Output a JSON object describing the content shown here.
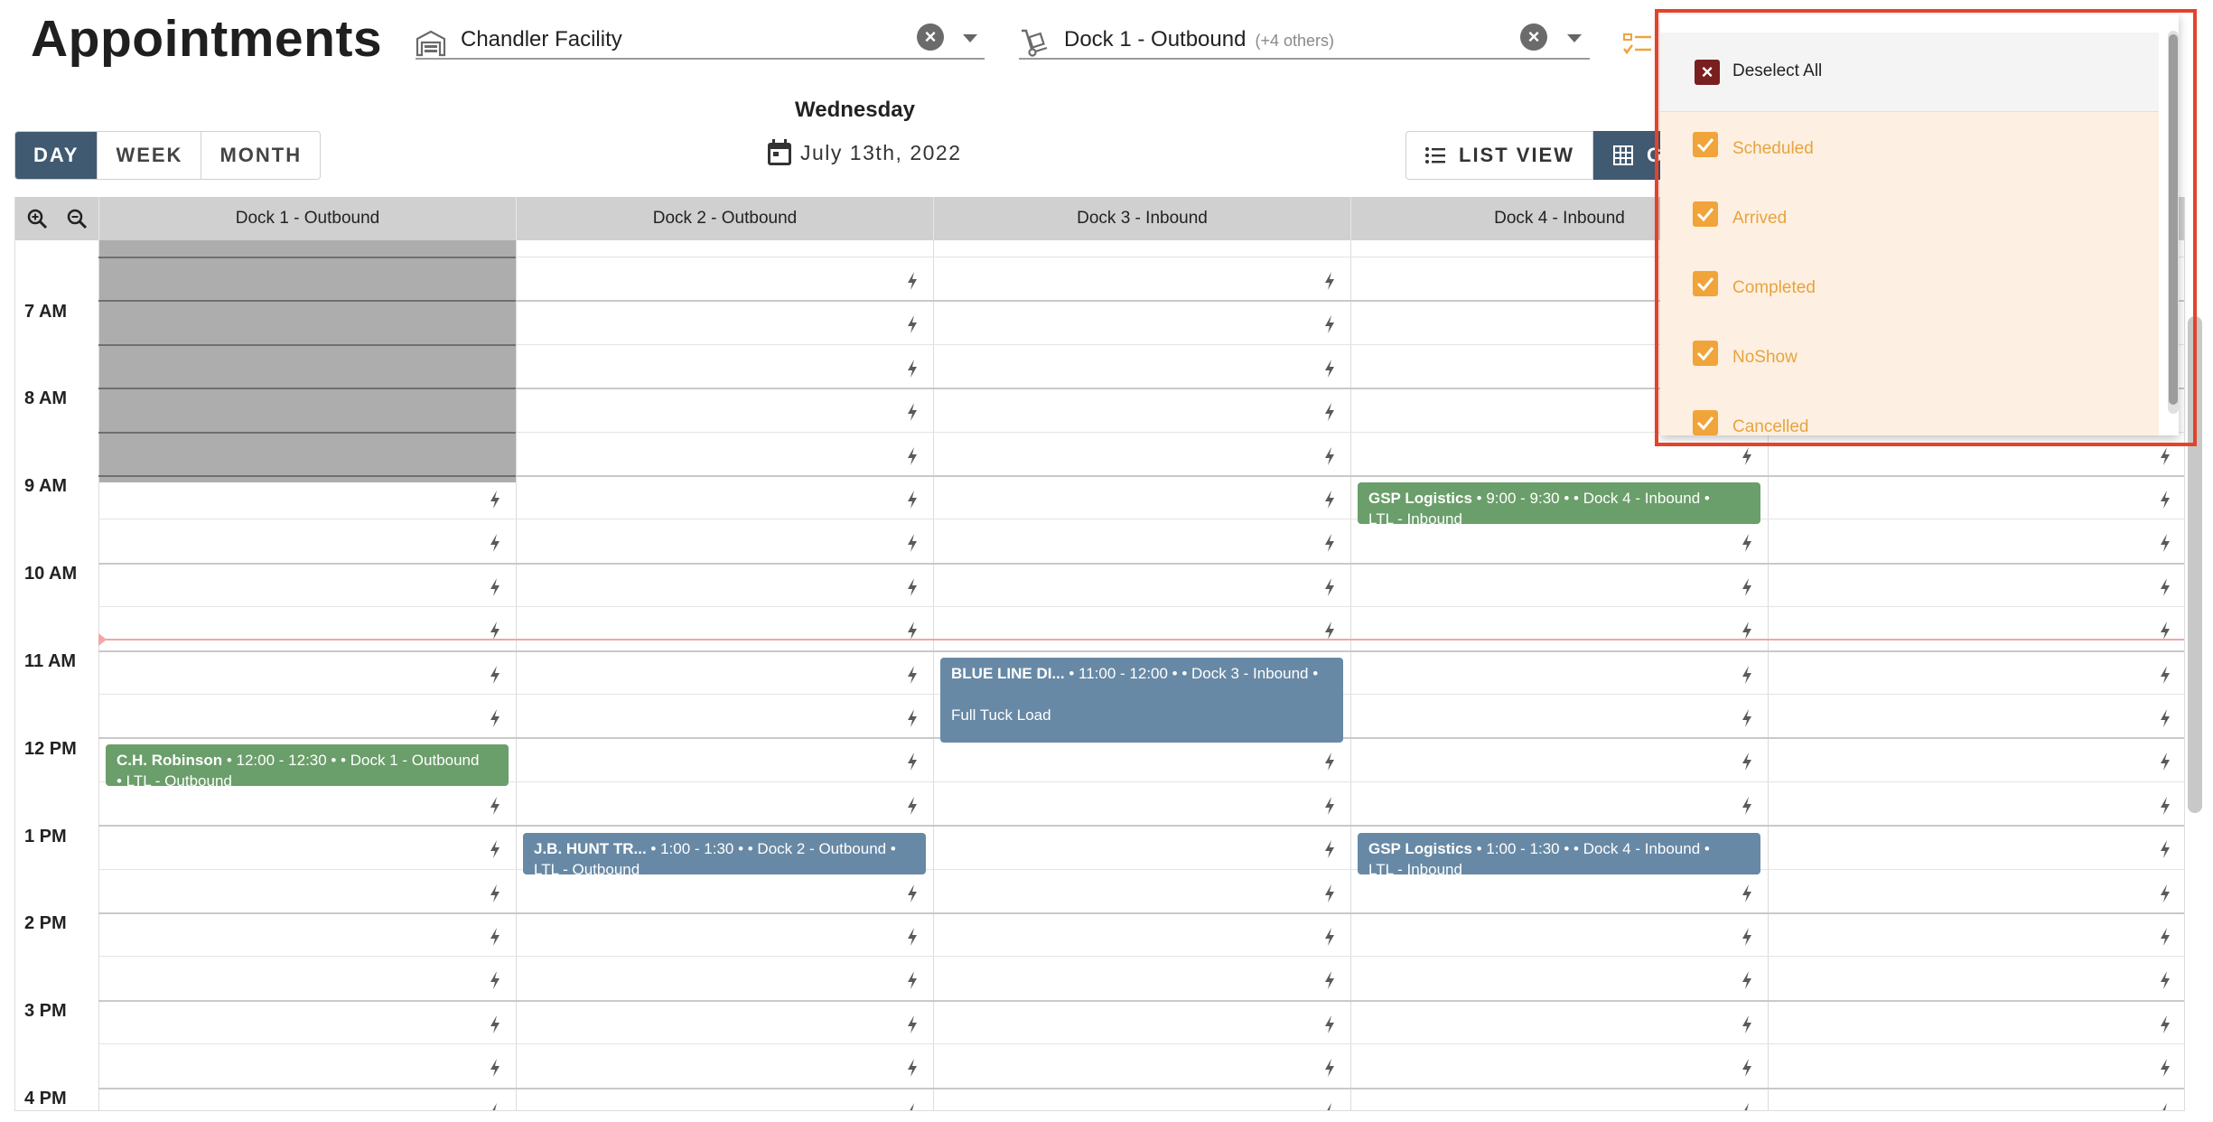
{
  "header": {
    "title": "Appointments",
    "facility_value": "Chandler Facility",
    "dock_value": "Dock 1 - Outbound",
    "dock_extra": "(+4 others)"
  },
  "views": {
    "day": "DAY",
    "week": "WEEK",
    "month": "MONTH",
    "list": "LIST VIEW",
    "grid": "GRI"
  },
  "date": {
    "weekday": "Wednesday",
    "date": "July 13th, 2022"
  },
  "calendar": {
    "columns": [
      "Dock 1 - Outbound",
      "Dock 2 - Outbound",
      "Dock 3 - Inbound",
      "Dock 4 - Inbound",
      ""
    ],
    "hours": [
      "7 AM",
      "8 AM",
      "9 AM",
      "10 AM",
      "11 AM",
      "12 PM",
      "1 PM",
      "2 PM",
      "3 PM",
      "4 PM"
    ]
  },
  "appointments": [
    {
      "title": "GSP Logistics",
      "meta": " • 9:00 - 9:30 •  • Dock 4 - Inbound •",
      "line2": "LTL - Inbound",
      "color": "#6a9e6a"
    },
    {
      "title": "BLUE LINE DI...",
      "meta": " • 11:00 - 12:00 •  • Dock 3 - Inbound •",
      "line2": "Full Tuck Load",
      "color": "#6789a5"
    },
    {
      "title": "C.H. Robinson",
      "meta": " • 12:00 - 12:30 •  • Dock 1 - Outbound",
      "line2": "• LTL - Outbound",
      "color": "#6a9e6a"
    },
    {
      "title": "J.B. HUNT TR...",
      "meta": " • 1:00 - 1:30 •  • Dock 2 - Outbound •",
      "line2": "LTL - Outbound",
      "color": "#6789a5"
    },
    {
      "title": "GSP Logistics",
      "meta": " • 1:00 - 1:30 •  • Dock 4 - Inbound •",
      "line2": "LTL - Inbound",
      "color": "#6789a5"
    }
  ],
  "status_dropdown": {
    "deselect_all": "Deselect All",
    "items": [
      "Scheduled",
      "Arrived",
      "Completed",
      "NoShow",
      "Cancelled"
    ]
  },
  "colors": {
    "accent": "#405a71",
    "status_orange": "#f0a43a",
    "highlight_red": "#e4432b"
  }
}
